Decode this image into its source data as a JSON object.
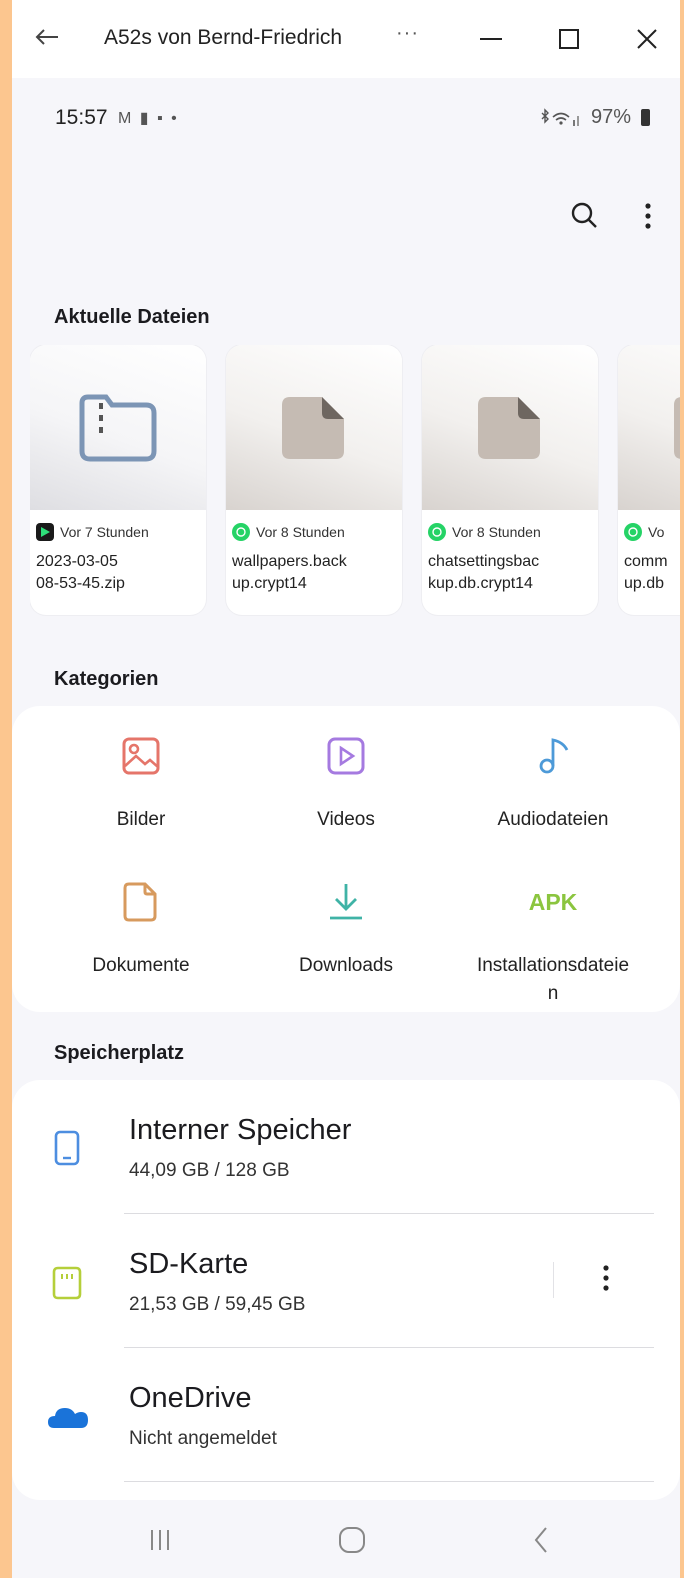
{
  "titlebar": {
    "title": "A52s von Bernd-Friedrich",
    "more": "···"
  },
  "statusbar": {
    "time": "15:57",
    "notifications": "M ▮ ▪ •",
    "battery": "97%"
  },
  "recent": {
    "title": "Aktuelle Dateien",
    "items": [
      {
        "age": "Vor 7 Stunden",
        "name": "2023-03-05\n08-53-45.zip",
        "app_icon": "play-icon",
        "thumb": "folder-zip-icon"
      },
      {
        "age": "Vor 8 Stunden",
        "name": "wallpapers.back\nup.crypt14",
        "app_icon": "whatsapp-icon",
        "thumb": "file-icon"
      },
      {
        "age": "Vor 8 Stunden",
        "name": "chatsettingsbac\nkup.db.crypt14",
        "app_icon": "whatsapp-icon",
        "thumb": "file-icon"
      },
      {
        "age": "Vo",
        "name": "comm\nup.db",
        "app_icon": "whatsapp-icon",
        "thumb": "file-icon"
      }
    ]
  },
  "categories": {
    "title": "Kategorien",
    "items": [
      {
        "label": "Bilder",
        "icon": "image-icon"
      },
      {
        "label": "Videos",
        "icon": "video-icon"
      },
      {
        "label": "Audiodateien",
        "icon": "music-icon"
      },
      {
        "label": "Dokumente",
        "icon": "document-icon"
      },
      {
        "label": "Downloads",
        "icon": "download-icon"
      },
      {
        "label": "Installationsdateie\nn",
        "icon": "apk-icon",
        "icon_text": "APK"
      }
    ]
  },
  "storage": {
    "title": "Speicherplatz",
    "items": [
      {
        "name": "Interner Speicher",
        "value": "44,09 GB / 128 GB",
        "icon": "phone-storage-icon"
      },
      {
        "name": "SD-Karte",
        "value": "21,53 GB / 59,45 GB",
        "icon": "sd-card-icon"
      },
      {
        "name": "OneDrive",
        "value": "Nicht angemeldet",
        "icon": "onedrive-cloud-icon"
      }
    ]
  },
  "colors": {
    "background": "#fcc68f",
    "bilder": "#e5756a",
    "videos": "#a57ae0",
    "audio": "#4d9ad8",
    "dokumente": "#d79a5e",
    "downloads": "#3fb3a6",
    "apk": "#8bc53f",
    "internal": "#4d8ee0",
    "sd": "#b5cf3a",
    "onedrive": "#1a73d9",
    "whatsapp": "#25d366"
  }
}
